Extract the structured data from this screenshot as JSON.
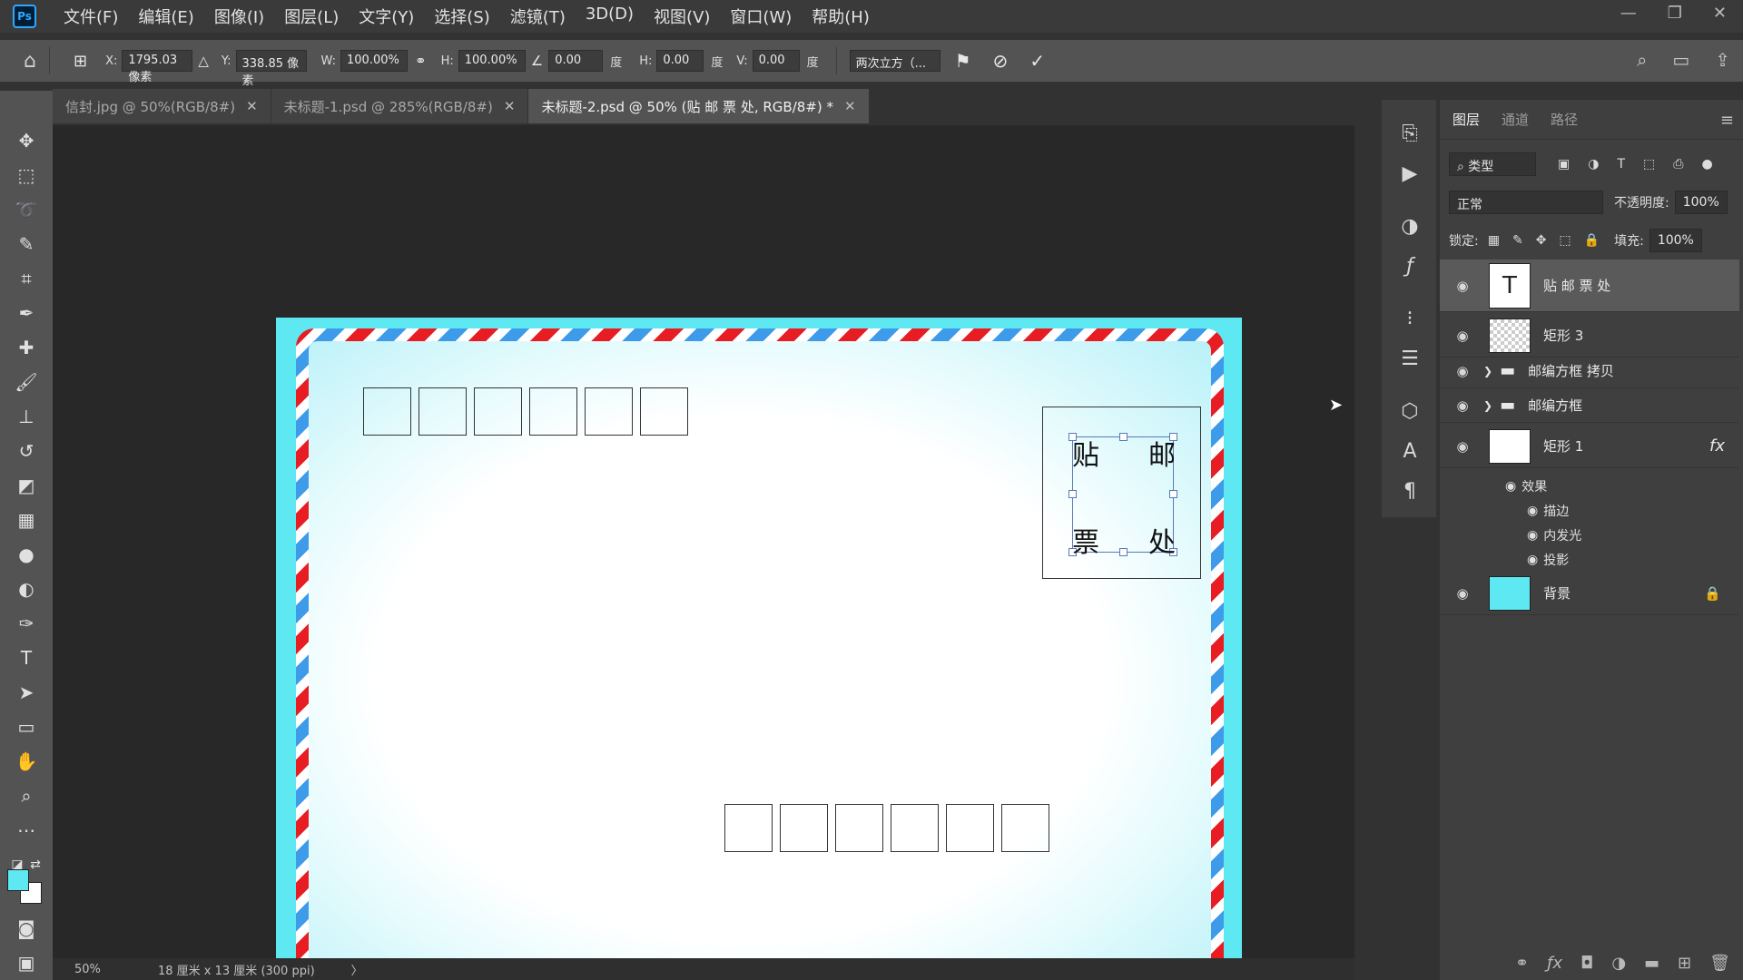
{
  "app": {
    "logo": "Ps",
    "menu": [
      "文件(F)",
      "编辑(E)",
      "图像(I)",
      "图层(L)",
      "文字(Y)",
      "选择(S)",
      "滤镜(T)",
      "3D(D)",
      "视图(V)",
      "窗口(W)",
      "帮助(H)"
    ],
    "window_controls": [
      "—",
      "❐",
      "✕"
    ]
  },
  "options": {
    "x_label": "X:",
    "x_value": "1795.03 像素",
    "y_label": "Y:",
    "y_value": "338.85 像素",
    "w_label": "W:",
    "w_value": "100.00%",
    "h_label": "H:",
    "h_value": "100.00%",
    "angle_value": "0.00",
    "angle_unit": "度",
    "hskew_label": "H:",
    "hskew_value": "0.00",
    "hskew_unit": "度",
    "vskew_label": "V:",
    "vskew_value": "0.00",
    "vskew_unit": "度",
    "interpolation": "两次立方（...",
    "cancel_icon": "⃠",
    "commit_icon": "✓"
  },
  "tabs": [
    {
      "label": "信封.jpg @ 50%(RGB/8#)",
      "close": "✕"
    },
    {
      "label": "未标题-1.psd @ 285%(RGB/8#)",
      "close": "✕"
    },
    {
      "label": "未标题-2.psd @ 50% (贴 邮 票 处, RGB/8#) *",
      "close": "✕"
    }
  ],
  "document": {
    "stamp_chars": [
      "贴",
      "邮",
      "票",
      "处"
    ],
    "zip_top_count": 6,
    "zip_bottom_count": 6,
    "colors": {
      "background": "#5ee8f2",
      "red_stripe": "#e81d24",
      "blue_stripe": "#3d9be9"
    }
  },
  "status": {
    "zoom": "50%",
    "doc_info": "18 厘米 x 13 厘米 (300 ppi)",
    "arrow": "〉"
  },
  "layers_panel": {
    "tabs": [
      "图层",
      "通道",
      "路径"
    ],
    "search_placeholder": "类型",
    "blend_mode": "正常",
    "opacity_label": "不透明度:",
    "opacity_value": "100%",
    "lock_label": "锁定:",
    "fill_label": "填充:",
    "fill_value": "100%",
    "layers": [
      {
        "name": "贴 邮 票 处",
        "type": "text",
        "thumb": "T"
      },
      {
        "name": "矩形 3",
        "type": "shape"
      },
      {
        "name": "邮编方框 拷贝",
        "type": "group"
      },
      {
        "name": "邮编方框",
        "type": "group"
      },
      {
        "name": "矩形 1",
        "type": "shape",
        "fx": "fx"
      },
      {
        "name": "背景",
        "type": "background"
      }
    ],
    "effects_label": "效果",
    "effects": [
      "描边",
      "内发光",
      "投影"
    ]
  },
  "colors": {
    "foreground": "#5ee8f2",
    "background_swatch": "#ffffff"
  }
}
